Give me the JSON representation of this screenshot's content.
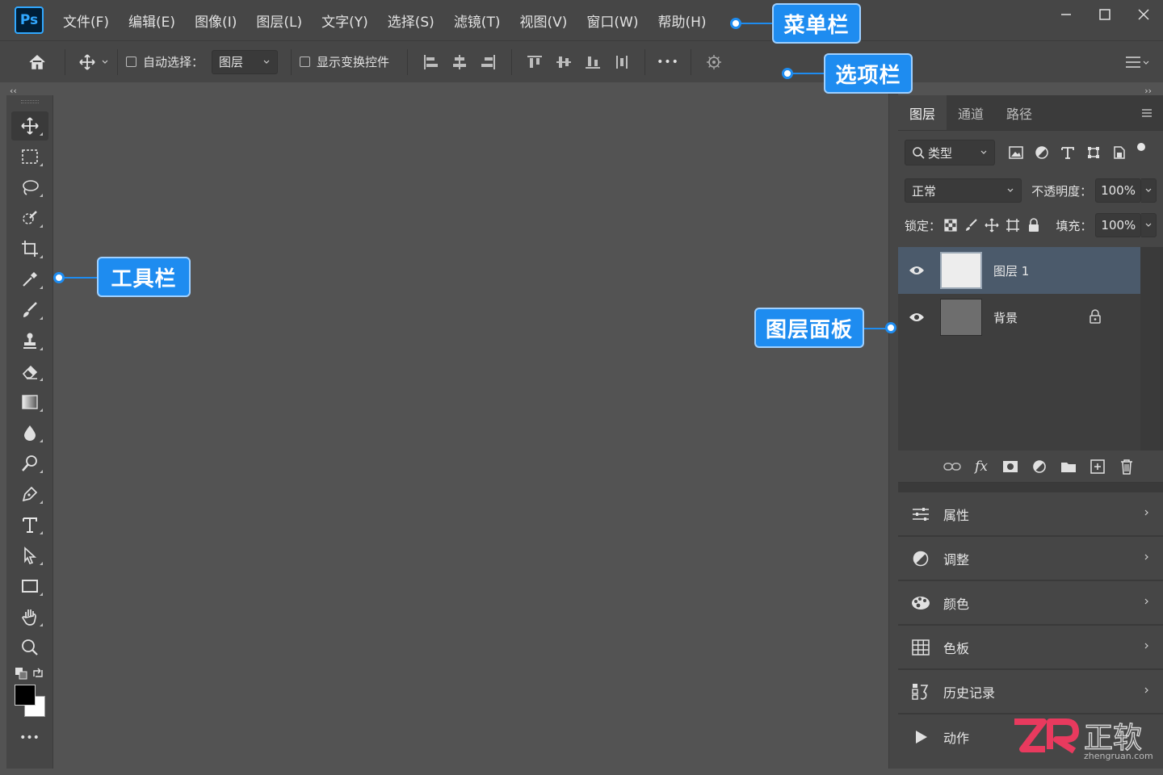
{
  "app": {
    "logo": "Ps"
  },
  "menu": [
    "文件(F)",
    "编辑(E)",
    "图像(I)",
    "图层(L)",
    "文字(Y)",
    "选择(S)",
    "滤镜(T)",
    "视图(V)",
    "窗口(W)",
    "帮助(H)"
  ],
  "options": {
    "auto_select_label": "自动选择：",
    "auto_select_value": "图层",
    "show_transform_label": "显示变换控件",
    "more": "•••"
  },
  "collapse": {
    "left": "‹‹",
    "right": "››"
  },
  "layers_panel": {
    "tabs": [
      "图层",
      "通道",
      "路径"
    ],
    "filter_label": "类型",
    "blend_mode": "正常",
    "opacity_label": "不透明度：",
    "opacity_value": "100%",
    "lock_label": "锁定：",
    "fill_label": "填充：",
    "fill_value": "100%",
    "layers": [
      {
        "name": "图层 1",
        "selected": true,
        "thumb_color": "#ededed"
      },
      {
        "name": "背景",
        "selected": false,
        "thumb_color": "#6e6e6e",
        "locked": true
      }
    ],
    "fx": "fx"
  },
  "sub_panels": [
    "属性",
    "调整",
    "颜色",
    "色板",
    "历史记录",
    "动作"
  ],
  "toolbar": {
    "more": "•••"
  },
  "callouts": {
    "menubar": "菜单栏",
    "optionsbar": "选项栏",
    "toolbar": "工具栏",
    "layers": "图层面板"
  },
  "watermark": {
    "brand": "正软",
    "url": "zhengruan.com"
  },
  "colors": {
    "accent": "#1e8cf0",
    "bg": "#535353",
    "panel": "#464646",
    "selected_layer": "#4b5a6b"
  }
}
